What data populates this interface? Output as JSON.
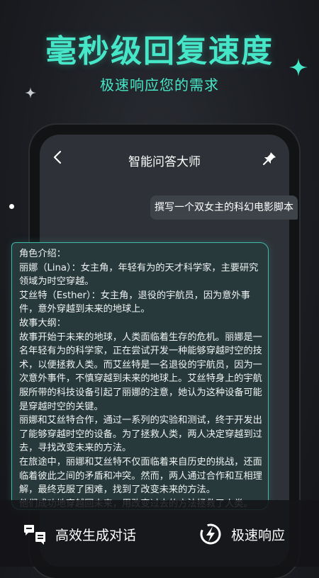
{
  "headline": "毫秒级回复速度",
  "subheadline": "极速响应您的需求",
  "chat": {
    "title": "智能问答大师",
    "user_message": "撰写一个双女主的科幻电影脚本",
    "reply_lines": [
      "角色介绍：",
      "丽娜（Lina）：女主角，年轻有为的天才科学家，主要研究领域为时空穿越。",
      "艾丝特（Esther）：女主角，退役的宇航员，因为意外事件，意外穿越到未来的地球上。",
      "故事大纲：",
      "故事开始于未来的地球，人类面临着生存的危机。丽娜是一名年轻有为的科学家，正在尝试开发一种能够穿越时空的技术，以便拯救人类。而艾丝特是一名退役的宇航员，因为一次意外事件，不慎穿越到未来的地球上。艾丝特身上的宇航服所带的科技设备引起了丽娜的注意，她认为这种设备可能是穿越时空的关键。",
      "丽娜和艾丝特合作，通过一系列的实验和测试，终于开发出了能够穿越时空的设备。为了拯救人类，两人决定穿越到过去，寻找改变未来的方法。",
      "在旅途中，丽娜和艾丝特不仅面临着来自历史的挑战，还面临着彼此之间的矛盾和冲突。然而，两人通过合作和互相理解，最终克服了困难，找到了改变未来的方法。",
      "他们成功地穿越回未来，用改变过去的方法拯救了人类。"
    ]
  },
  "bottom": {
    "feature_left": "高效生成对话",
    "feature_right": "极速响应"
  },
  "colors": {
    "accent": "#46e6c8",
    "card_border": "#3fb9a8",
    "card_bg": "#27393b",
    "background": "#1c1e23"
  },
  "icons": [
    "back-icon",
    "pin-icon",
    "chat-generate-icon",
    "speed-icon",
    "sparkle-icon"
  ]
}
